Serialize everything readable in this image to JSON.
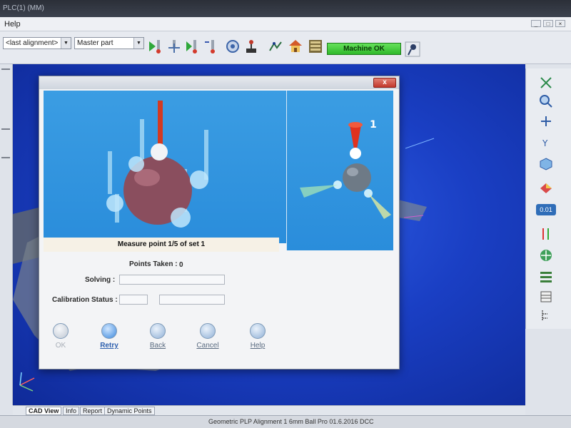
{
  "window": {
    "title": "PLC(1) (MM)",
    "controls": [
      "_",
      "□",
      "×"
    ]
  },
  "menubar": {
    "help_label": "Help"
  },
  "toolbar": {
    "alignment_select": "<last alignment>",
    "part_select": "Master part",
    "machine_status": "Machine OK",
    "icons": [
      "run-icon",
      "probe-move-icon",
      "probe-down-icon",
      "probe-calibrate-icon",
      "scan-icon",
      "joystick-icon",
      "touch-icon",
      "home-icon",
      "database-icon",
      "microphone-icon"
    ]
  },
  "dialog": {
    "close_label": "x",
    "measure_label": "Measure point 1/5 of set 1",
    "points_taken_label": "Points Taken :",
    "points_taken_value": "0",
    "solving_label": "Solving :",
    "calibration_label": "Calibration Status :",
    "callout_number": "1",
    "buttons": {
      "ok": "OK",
      "retry": "Retry",
      "back": "Back",
      "cancel": "Cancel",
      "help": "Help"
    }
  },
  "right_tools": {
    "icons": [
      "fit-view-icon",
      "zoom-icon",
      "rotate-icon",
      "axis-y-icon",
      "view-cube-icon",
      "shaded-icon",
      "coord-readout-icon",
      "alignment-icon",
      "compass-icon",
      "list-icon",
      "table-icon",
      "tree-icon"
    ],
    "coord_label": "0.01"
  },
  "bottom_tabs": [
    "CAD View",
    "Info",
    "Report",
    "Dynamic Points"
  ],
  "status_text": "Geometric PLP Alignment 1   6mm Ball Pro   01.6.2016   DCC"
}
